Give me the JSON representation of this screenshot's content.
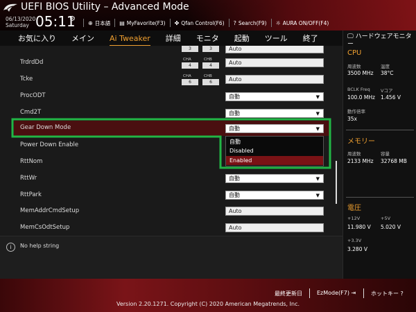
{
  "header": {
    "title": "UEFI BIOS Utility – Advanced Mode",
    "date": "06/13/2020",
    "day": "Saturday",
    "time": "05:11",
    "toolbar": {
      "language": "日本語",
      "myfavorite": "MyFavorite(F3)",
      "qfan": "Qfan Control(F6)",
      "search": "Search(F9)",
      "aura": "AURA ON/OFF(F4)"
    }
  },
  "menu": {
    "items": [
      "お気に入り",
      "メイン",
      "Ai Tweaker",
      "詳細",
      "モニタ",
      "起動",
      "ツール",
      "終了"
    ],
    "active_index": 2
  },
  "settings": {
    "top_chbox_left": "3",
    "top_chbox_right": "3",
    "top_field": "Auto",
    "trdrddd": {
      "label": "TrdrdDd",
      "cha_label": "CHA",
      "cha": "4",
      "chb_label": "CHB",
      "chb": "4",
      "value": "Auto"
    },
    "tcke": {
      "label": "Tcke",
      "cha_label": "CHA",
      "cha": "6",
      "chb_label": "CHB",
      "chb": "6",
      "value": "Auto"
    },
    "procodt": {
      "label": "ProcODT",
      "value": "自動"
    },
    "cmd2t": {
      "label": "Cmd2T",
      "value": "自動"
    },
    "geardown": {
      "label": "Gear Down Mode",
      "value": "自動"
    },
    "powerdown": {
      "label": "Power Down Enable"
    },
    "rttnom": {
      "label": "RttNom"
    },
    "rttwr": {
      "label": "RttWr",
      "value": "自動"
    },
    "rttpark": {
      "label": "RttPark",
      "value": "自動"
    },
    "memaddr": {
      "label": "MemAddrCmdSetup",
      "value": "Auto"
    },
    "memcs": {
      "label": "MemCsOdtSetup",
      "value": "Auto"
    }
  },
  "dropdown_options": [
    "自動",
    "Disabled",
    "Enabled"
  ],
  "dropdown_selected_index": 2,
  "help": {
    "text": "No help string"
  },
  "hardware": {
    "title": "ハードウェアモニター",
    "cpu": {
      "section": "CPU",
      "freq_label": "周波数",
      "freq": "3500 MHz",
      "temp_label": "温度",
      "temp": "38°C",
      "bclk_label": "BCLK Freq",
      "bclk": "100.0 MHz",
      "vcore_label": "Vコア",
      "vcore": "1.456 V",
      "ratio_label": "動作倍率",
      "ratio": "35x"
    },
    "memory": {
      "section": "メモリー",
      "freq_label": "周波数",
      "freq": "2133 MHz",
      "cap_label": "容量",
      "cap": "32768 MB"
    },
    "voltage": {
      "section": "電圧",
      "v12_label": "+12V",
      "v12": "11.980 V",
      "v5_label": "+5V",
      "v5": "5.020 V",
      "v33_label": "+3.3V",
      "v33": "3.280 V"
    }
  },
  "footer": {
    "last_modified": "最終更新日",
    "ezmode": "EzMode(F7)",
    "hotkeys": "ホットキー",
    "version": "Version 2.20.1271. Copyright (C) 2020 American Megatrends, Inc."
  },
  "colors": {
    "accent": "#f0a030",
    "highlight_row": "#4a0f10",
    "annotation_box": "#22b545",
    "selected_option": "#7a1215"
  }
}
